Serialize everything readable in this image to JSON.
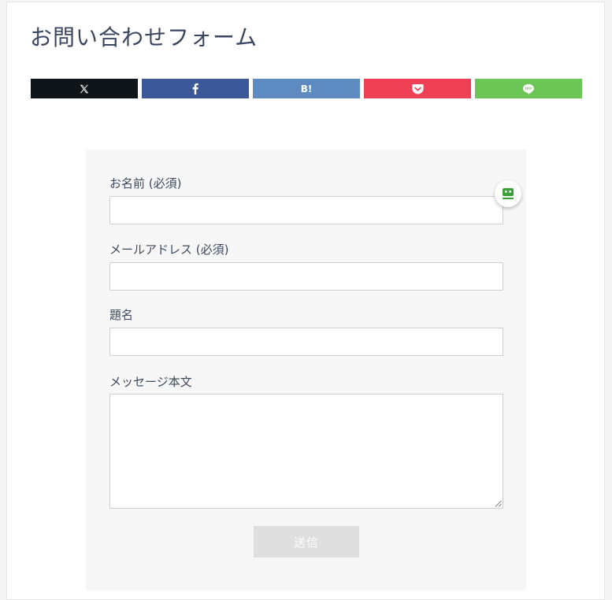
{
  "page": {
    "title": "お問い合わせフォーム"
  },
  "share": {
    "buttons": [
      {
        "id": "x",
        "icon": "x-logo-icon",
        "color": "#0f1419"
      },
      {
        "id": "facebook",
        "icon": "facebook-f-icon",
        "color": "#3b5998"
      },
      {
        "id": "hatena",
        "icon": "hatena-bookmark-icon",
        "label": "B!",
        "color": "#5d8ac1"
      },
      {
        "id": "pocket",
        "icon": "pocket-icon",
        "color": "#ef4056"
      },
      {
        "id": "line",
        "icon": "line-chat-icon",
        "color": "#6cc655"
      }
    ]
  },
  "form": {
    "name_label": "お名前 (必須)",
    "email_label": "メールアドレス (必須)",
    "subject_label": "題名",
    "message_label": "メッセージ本文",
    "submit_label": "送信",
    "name_value": "",
    "email_value": "",
    "subject_value": "",
    "message_value": ""
  },
  "helper": {
    "icon": "robot-face-icon",
    "color": "#3aa13a"
  }
}
